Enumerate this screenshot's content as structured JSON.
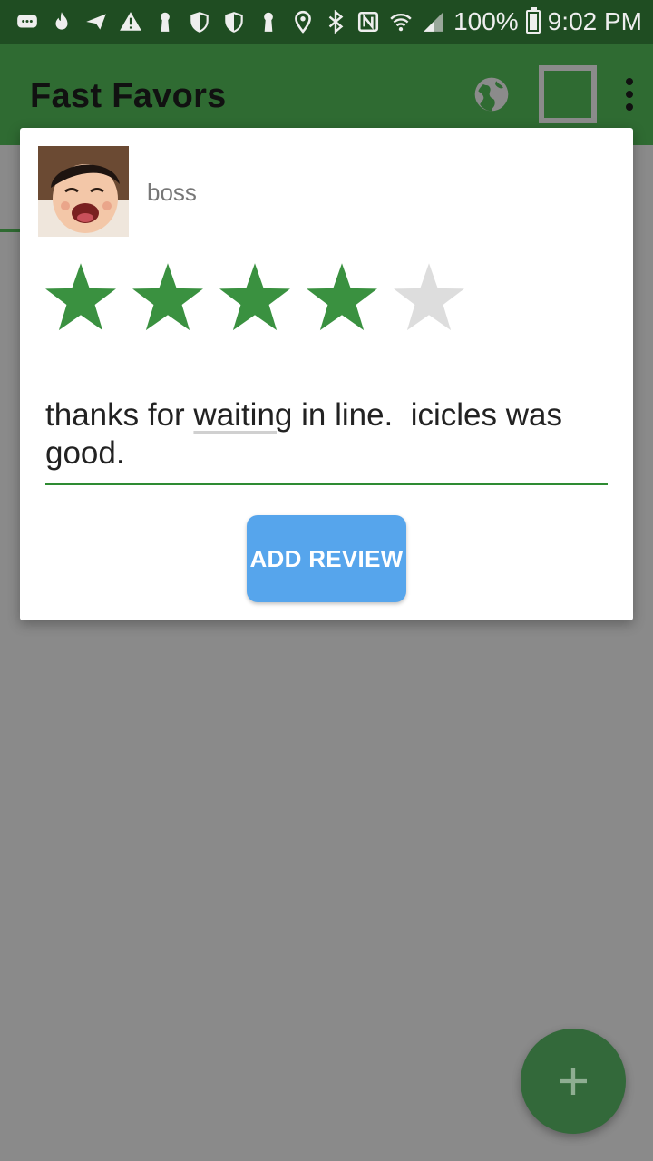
{
  "status_bar": {
    "battery_text": "100%",
    "time": "9:02 PM",
    "left_icons": [
      "message-icon",
      "fire-icon",
      "send-icon",
      "warning-icon",
      "keyhole-icon",
      "shield-icon",
      "shield-icon",
      "keyhole-icon"
    ],
    "right_icons": [
      "location-icon",
      "bluetooth-icon",
      "nfc-icon",
      "wifi-icon",
      "signal-icon",
      "battery-icon"
    ]
  },
  "app_bar": {
    "title": "Fast Favors",
    "actions": [
      "globe-icon",
      "grid-icon",
      "more-vert-icon"
    ]
  },
  "review_dialog": {
    "username": "boss",
    "rating": 4,
    "max_rating": 5,
    "review_text_part1": "thanks for ",
    "review_text_misspelled": "waiting",
    "review_text_part2": " in line.  icicles was good.",
    "submit_label": "ADD REVIEW"
  },
  "fab": {
    "icon": "plus-icon"
  },
  "colors": {
    "status_bar": "#1f4d22",
    "app_bar": "#2f6b32",
    "star_filled": "#3a9140",
    "star_empty": "#dddddd",
    "button": "#56a5ec",
    "scrim": "#8a8a8a"
  }
}
